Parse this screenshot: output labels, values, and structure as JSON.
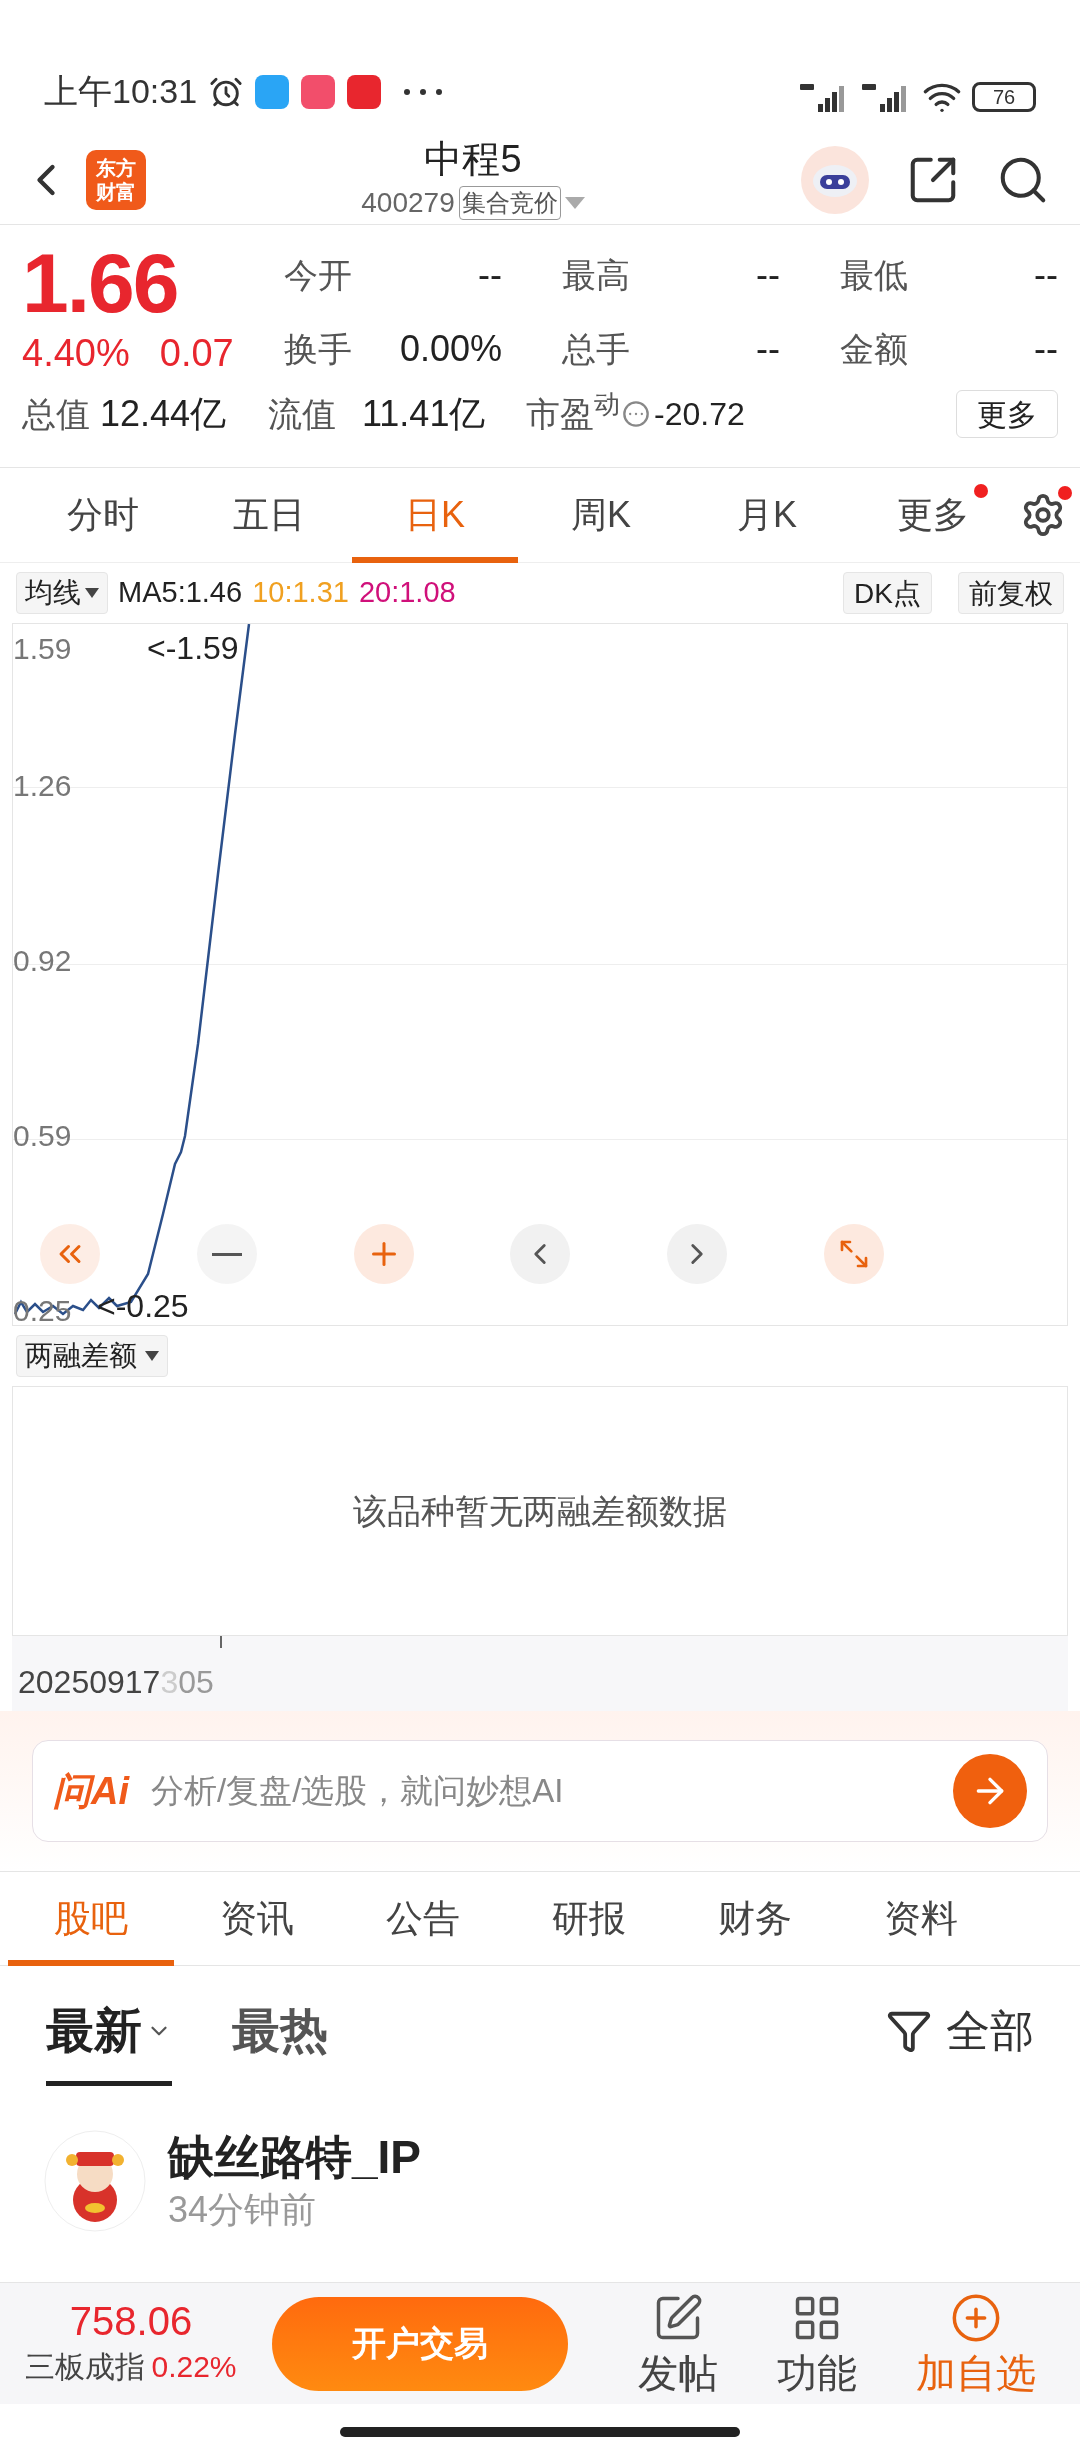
{
  "status_bar": {
    "time": "上午10:31",
    "battery": "76"
  },
  "header": {
    "logo_lines": [
      "东方",
      "财富"
    ],
    "title": "中程5",
    "code": "400279",
    "badge": "集合竞价"
  },
  "quote": {
    "price": "1.66",
    "change_pct": "4.40%",
    "change": "0.07",
    "stats": [
      {
        "label": "今开",
        "value": "--"
      },
      {
        "label": "最高",
        "value": "--"
      },
      {
        "label": "最低",
        "value": "--"
      },
      {
        "label": "换手",
        "value": "0.00%"
      },
      {
        "label": "总手",
        "value": "--"
      },
      {
        "label": "金额",
        "value": "--"
      }
    ],
    "total_value": {
      "label": "总值",
      "value": "12.44亿"
    },
    "float_value": {
      "label": "流值",
      "value": "11.41亿"
    },
    "pe": {
      "label": "市盈$^{动}$",
      "value": "-20.72"
    },
    "more_button": "更多"
  },
  "period_tabs": [
    {
      "label": "分时",
      "selected": false,
      "dot": false
    },
    {
      "label": "五日",
      "selected": false,
      "dot": false
    },
    {
      "label": "日K",
      "selected": true,
      "dot": false
    },
    {
      "label": "周K",
      "selected": false,
      "dot": false
    },
    {
      "label": "月K",
      "selected": false,
      "dot": false
    },
    {
      "label": "更多",
      "selected": false,
      "dot": true
    }
  ],
  "settings_dot": true,
  "chart_bar": {
    "indicator": "均线",
    "ma": [
      {
        "text": "MA5:1.46",
        "color": "#222222"
      },
      {
        "text": "10:1.31",
        "color": "#f0a020"
      },
      {
        "text": "20:1.08",
        "color": "#d0107a"
      }
    ],
    "dk_button": "DK点",
    "adjust_button": "前复权"
  },
  "chart": {
    "y_labels": [
      "1.59",
      "1.26",
      "0.92",
      "0.59",
      "0.25"
    ],
    "high_marker": "<-1.59",
    "low_marker": "<-0.25"
  },
  "sub_indicator": {
    "label": "两融差额",
    "empty_text": "该品种暂无两融差额数据"
  },
  "date_label": "20250917",
  "date_label_faded": "3",
  "date_label_tail": "05",
  "ai_bar": {
    "logo": "问Ai",
    "placeholder": "分析/复盘/选股，就问妙想AI"
  },
  "content_tabs": [
    {
      "label": "股吧",
      "selected": true
    },
    {
      "label": "资讯",
      "selected": false
    },
    {
      "label": "公告",
      "selected": false
    },
    {
      "label": "研报",
      "selected": false
    },
    {
      "label": "财务",
      "selected": false
    },
    {
      "label": "资料",
      "selected": false
    }
  ],
  "sort_tabs": [
    {
      "label": "最新",
      "selected": true,
      "dropdown": true
    },
    {
      "label": "最热",
      "selected": false,
      "dropdown": false
    }
  ],
  "filter": "全部",
  "post": {
    "author": "缺丝路特_IP",
    "time": "34分钟前"
  },
  "bottom_bar": {
    "index_value": "758.06",
    "index_name": "三板成指",
    "index_change": "0.22%",
    "trade_button": "开户交易",
    "actions": [
      {
        "kind": "post",
        "label": "发帖",
        "highlight": false
      },
      {
        "kind": "tools",
        "label": "功能",
        "highlight": false
      },
      {
        "kind": "add",
        "label": "加自选",
        "highlight": true
      }
    ]
  }
}
